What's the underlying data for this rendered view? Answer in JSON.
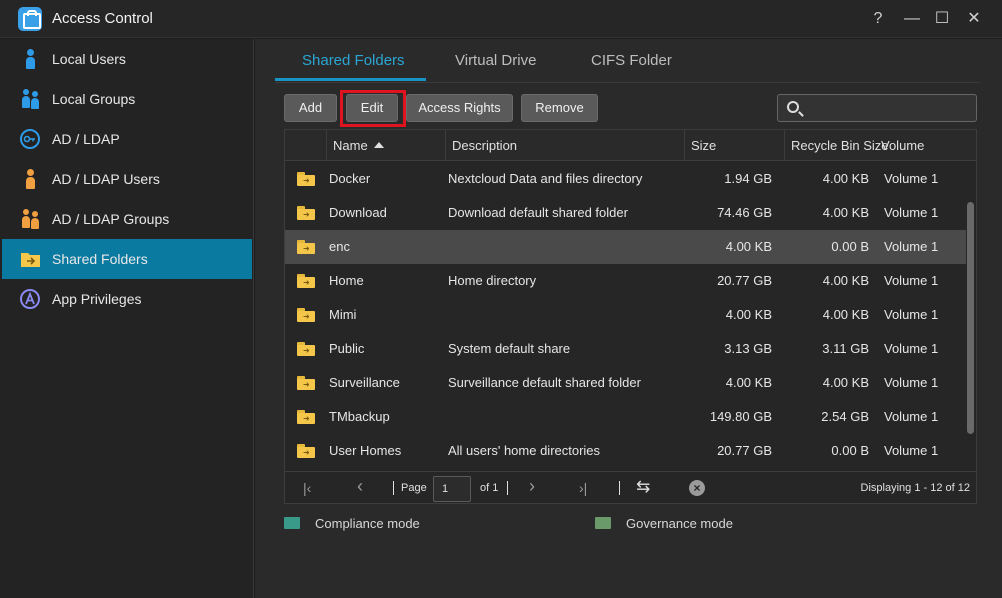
{
  "window": {
    "title": "Access Control",
    "controls": [
      "?",
      "—",
      "☐",
      "✕"
    ]
  },
  "sidebar": {
    "items": [
      {
        "label": "Local Users",
        "icon": "user-icon"
      },
      {
        "label": "Local Groups",
        "icon": "group-icon"
      },
      {
        "label": "AD / LDAP",
        "icon": "key-icon"
      },
      {
        "label": "AD / LDAP Users",
        "icon": "ldap-user-icon"
      },
      {
        "label": "AD / LDAP Groups",
        "icon": "ldap-group-icon"
      },
      {
        "label": "Shared Folders",
        "icon": "shared-folder-icon",
        "active": true
      },
      {
        "label": "App Privileges",
        "icon": "app-privileges-icon"
      }
    ]
  },
  "tabs": [
    {
      "label": "Shared Folders",
      "active": true
    },
    {
      "label": "Virtual Drive"
    },
    {
      "label": "CIFS Folder"
    }
  ],
  "toolbar": {
    "add_label": "Add",
    "edit_label": "Edit",
    "access_rights_label": "Access Rights",
    "remove_label": "Remove",
    "search_placeholder": ""
  },
  "table": {
    "columns": [
      "Name",
      "Description",
      "Size",
      "Recycle Bin Size",
      "Volume"
    ],
    "rows": [
      {
        "name": "Docker",
        "description": "Nextcloud Data and files directory",
        "size": "1.94 GB",
        "recycle": "4.00 KB",
        "volume": "Volume 1"
      },
      {
        "name": "Download",
        "description": "Download default shared folder",
        "size": "74.46 GB",
        "recycle": "4.00 KB",
        "volume": "Volume 1"
      },
      {
        "name": "enc",
        "description": "",
        "size": "4.00 KB",
        "recycle": "0.00 B",
        "volume": "Volume 1",
        "selected": true
      },
      {
        "name": "Home",
        "description": "Home directory",
        "size": "20.77 GB",
        "recycle": "4.00 KB",
        "volume": "Volume 1"
      },
      {
        "name": "Mimi",
        "description": "",
        "size": "4.00 KB",
        "recycle": "4.00 KB",
        "volume": "Volume 1"
      },
      {
        "name": "Public",
        "description": "System default share",
        "size": "3.13 GB",
        "recycle": "3.11 GB",
        "volume": "Volume 1"
      },
      {
        "name": "Surveillance",
        "description": "Surveillance default shared folder",
        "size": "4.00 KB",
        "recycle": "4.00 KB",
        "volume": "Volume 1"
      },
      {
        "name": "TMbackup",
        "description": "",
        "size": "149.80 GB",
        "recycle": "2.54 GB",
        "volume": "Volume 1"
      },
      {
        "name": "User Homes",
        "description": "All users' home directories",
        "size": "20.77 GB",
        "recycle": "0.00 B",
        "volume": "Volume 1"
      }
    ]
  },
  "pager": {
    "page_label": "Page",
    "page_value": "1",
    "of_label": "of 1",
    "displaying": "Displaying 1 - 12 of 12"
  },
  "legend": {
    "compliance": "Compliance mode",
    "governance": "Governance mode"
  },
  "colors": {
    "accent": "#0b7aa0",
    "tab_active": "#2ba6d4",
    "highlight": "#e0141e",
    "folder": "#f4c64a"
  }
}
